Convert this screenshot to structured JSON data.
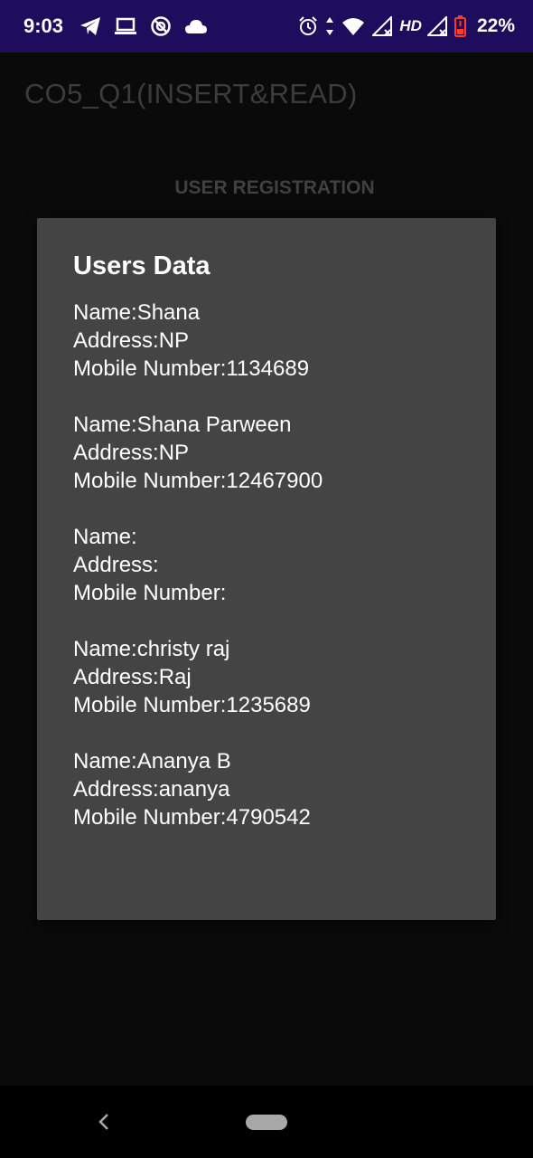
{
  "status_bar": {
    "time": "9:03",
    "network_label": "HD",
    "battery": "22%",
    "left_icons": [
      "telegram-icon",
      "laptop-icon",
      "sync-icon",
      "cloud-icon"
    ],
    "right_icons": [
      "alarm-icon",
      "data-arrows-icon",
      "wifi-icon",
      "signal-icon",
      "signal-icon",
      "battery-icon"
    ],
    "battery_color": "#ff3b30"
  },
  "app_bar": {
    "title": "CO5_Q1(INSERT&READ)"
  },
  "main": {
    "heading": "USER REGISTRATION"
  },
  "dialog": {
    "title": "Users Data",
    "records": [
      {
        "name": "Name:Shana",
        "address": "Address:NP",
        "mobile": "Mobile Number:1134689"
      },
      {
        "name": "Name:Shana Parween",
        "address": "Address:NP",
        "mobile": "Mobile Number:12467900"
      },
      {
        "name": "Name:",
        "address": "Address:",
        "mobile": "Mobile Number:"
      },
      {
        "name": "Name:christy raj",
        "address": "Address:Raj",
        "mobile": "Mobile Number:1235689"
      },
      {
        "name": "Name:Ananya B",
        "address": "Address:ananya",
        "mobile": "Mobile Number:4790542"
      }
    ]
  },
  "nav_bar": {
    "icons": [
      "back-icon",
      "home-pill"
    ]
  },
  "colors": {
    "status_bar_bg": "#1e0d5c",
    "background": "#0a0a0a",
    "dialog_bg": "#444444"
  }
}
